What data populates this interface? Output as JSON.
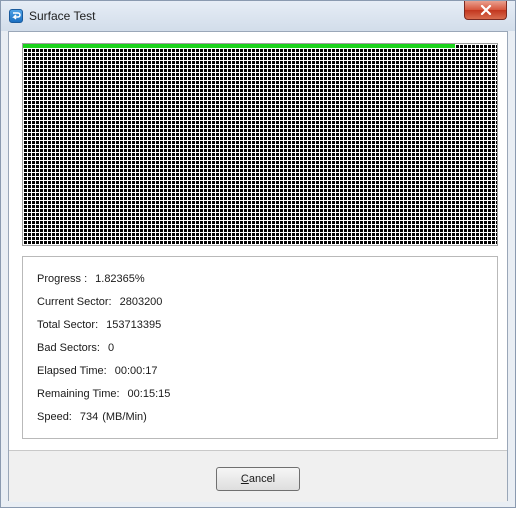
{
  "window": {
    "title": "Surface Test",
    "icons": {
      "app": "app-icon",
      "close": "close-icon"
    }
  },
  "sector_map": {
    "progress_fraction": 0.0182365,
    "colors": {
      "completed": "#1bd21b",
      "pending": "#000000",
      "grid": "#ffffff"
    }
  },
  "info": {
    "progress": {
      "label": "Progress :",
      "value": "1.82365%"
    },
    "current_sector": {
      "label": "Current Sector:",
      "value": "2803200"
    },
    "total_sector": {
      "label": "Total Sector:",
      "value": "153713395"
    },
    "bad_sectors": {
      "label": "Bad Sectors:",
      "value": "0"
    },
    "elapsed_time": {
      "label": "Elapsed Time:",
      "value": "00:00:17"
    },
    "remaining_time": {
      "label": "Remaining Time:",
      "value": "00:15:15"
    },
    "speed": {
      "label": "Speed:",
      "value": "734",
      "unit": "(MB/Min)"
    }
  },
  "footer": {
    "cancel_label_mnemonic": "C",
    "cancel_label_rest": "ancel"
  }
}
